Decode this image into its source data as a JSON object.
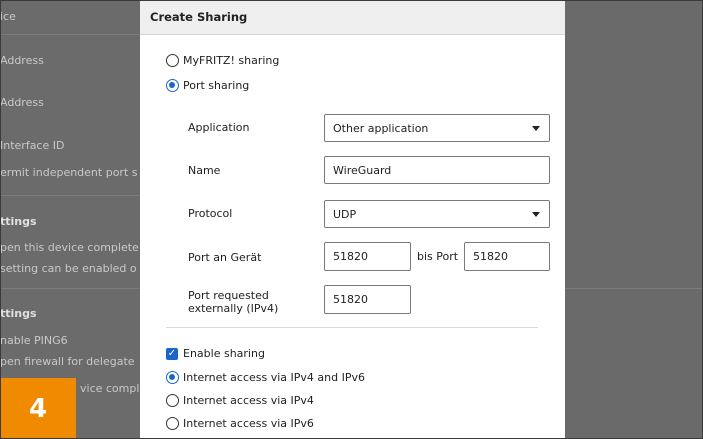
{
  "background": {
    "items": [
      {
        "text": "ice",
        "bold": false
      },
      {
        "text": "Address",
        "bold": false
      },
      {
        "text": "Address",
        "bold": false
      },
      {
        "text": "Interface ID",
        "bold": false
      },
      {
        "text": "ermit independent port s",
        "bold": false
      },
      {
        "text": "ttings",
        "bold": true
      },
      {
        "text": "pen this device complete",
        "bold": false
      },
      {
        "text": "setting can be enabled o",
        "bold": false
      },
      {
        "text": "ttings",
        "bold": true
      },
      {
        "text": "nable PING6",
        "bold": false
      },
      {
        "text": "pen firewall for delegate",
        "bold": false
      },
      {
        "text": "vice complete",
        "bold": false
      }
    ]
  },
  "dialog": {
    "title": "Create Sharing",
    "sharing_type": {
      "options": [
        {
          "label": "MyFRITZ! sharing",
          "selected": false
        },
        {
          "label": "Port sharing",
          "selected": true
        }
      ]
    },
    "fields": {
      "application": {
        "label": "Application",
        "value": "Other application"
      },
      "name": {
        "label": "Name",
        "value": "WireGuard"
      },
      "protocol": {
        "label": "Protocol",
        "value": "UDP"
      },
      "port_device": {
        "label": "Port an Gerät",
        "value": "51820",
        "to_label": "bis Port",
        "to_value": "51820"
      },
      "port_external": {
        "label": "Port requested externally (IPv4)",
        "value": "51820"
      }
    },
    "enable_sharing": {
      "label": "Enable sharing",
      "checked": true
    },
    "internet_access": {
      "options": [
        {
          "label": "Internet access via IPv4 and IPv6",
          "selected": true
        },
        {
          "label": "Internet access via IPv4",
          "selected": false
        },
        {
          "label": "Internet access via IPv6",
          "selected": false
        }
      ]
    }
  },
  "step_badge": "4",
  "colors": {
    "accent": "#1a66c8",
    "badge": "#f08a00",
    "overlay": "#6b6b6b"
  }
}
